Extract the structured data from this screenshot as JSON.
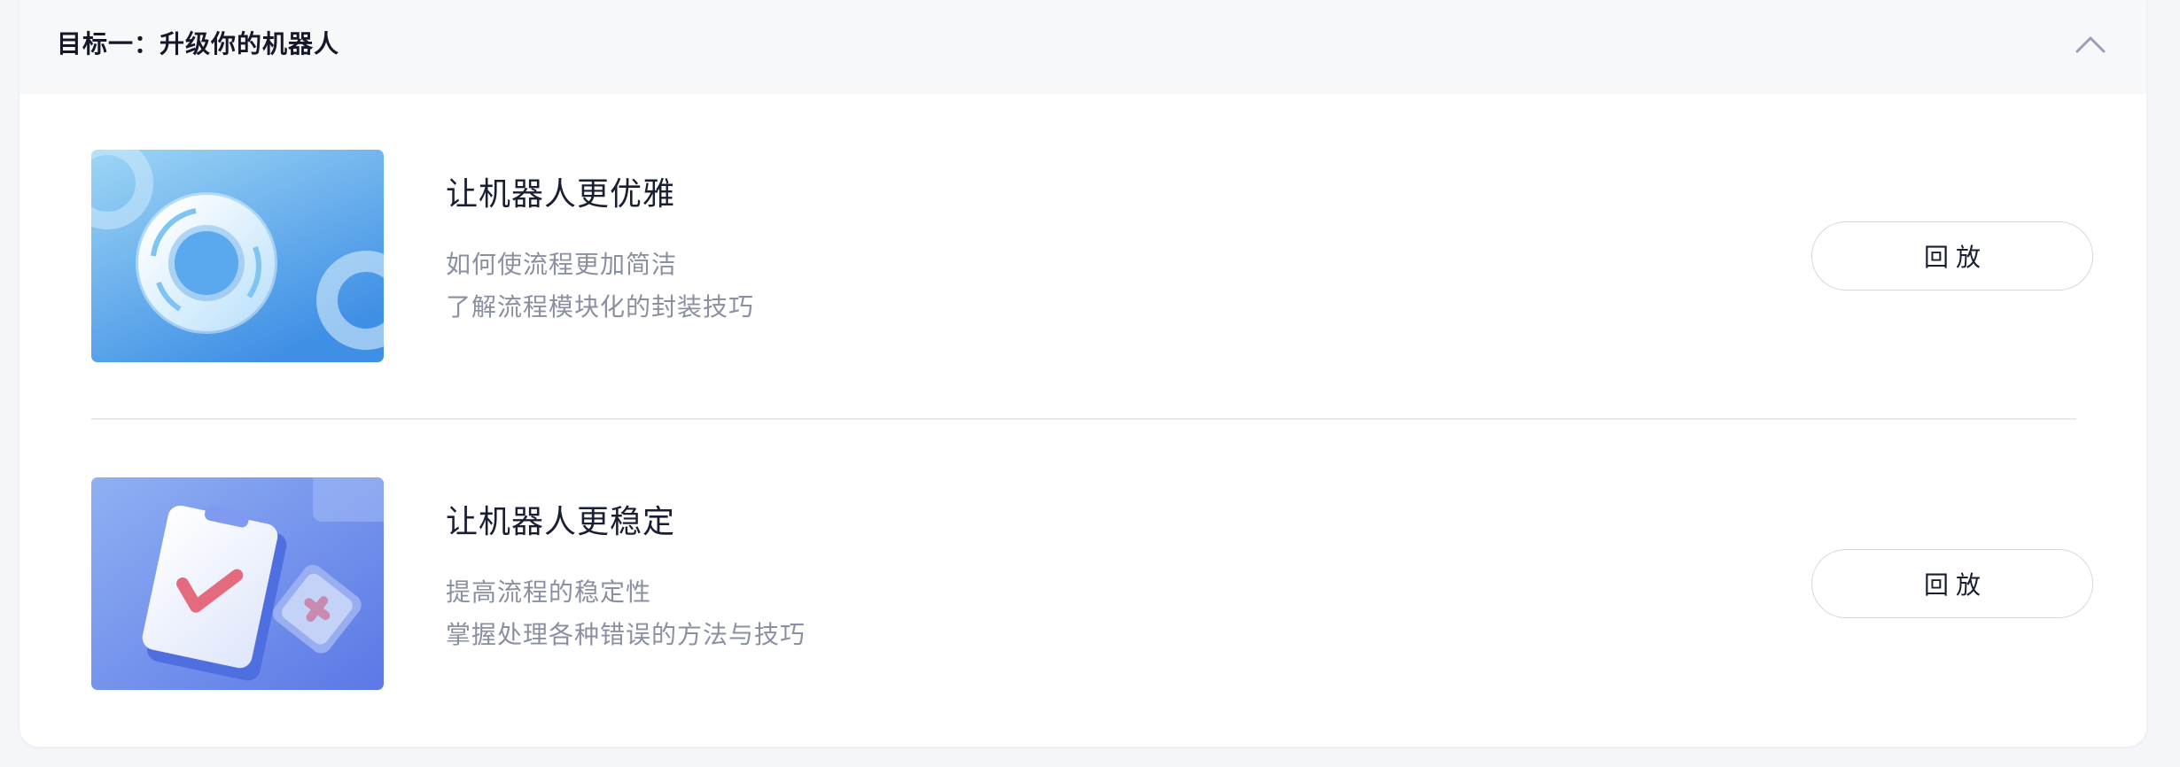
{
  "section": {
    "title": "目标一：升级你的机器人",
    "collapse_icon": "chevron-up-icon"
  },
  "courses": [
    {
      "title": "让机器人更优雅",
      "desc_line_1": "如何使流程更加简洁",
      "desc_line_2": "了解流程模块化的封装技巧",
      "button_label": "回放",
      "thumbnail": "refresh-cycle-illustration",
      "accent": "#5aa9ee"
    },
    {
      "title": "让机器人更稳定",
      "desc_line_1": "提高流程的稳定性",
      "desc_line_2": "掌握处理各种错误的方法与技巧",
      "button_label": "回放",
      "thumbnail": "clipboard-check-illustration",
      "accent": "#6a86ea"
    }
  ]
}
